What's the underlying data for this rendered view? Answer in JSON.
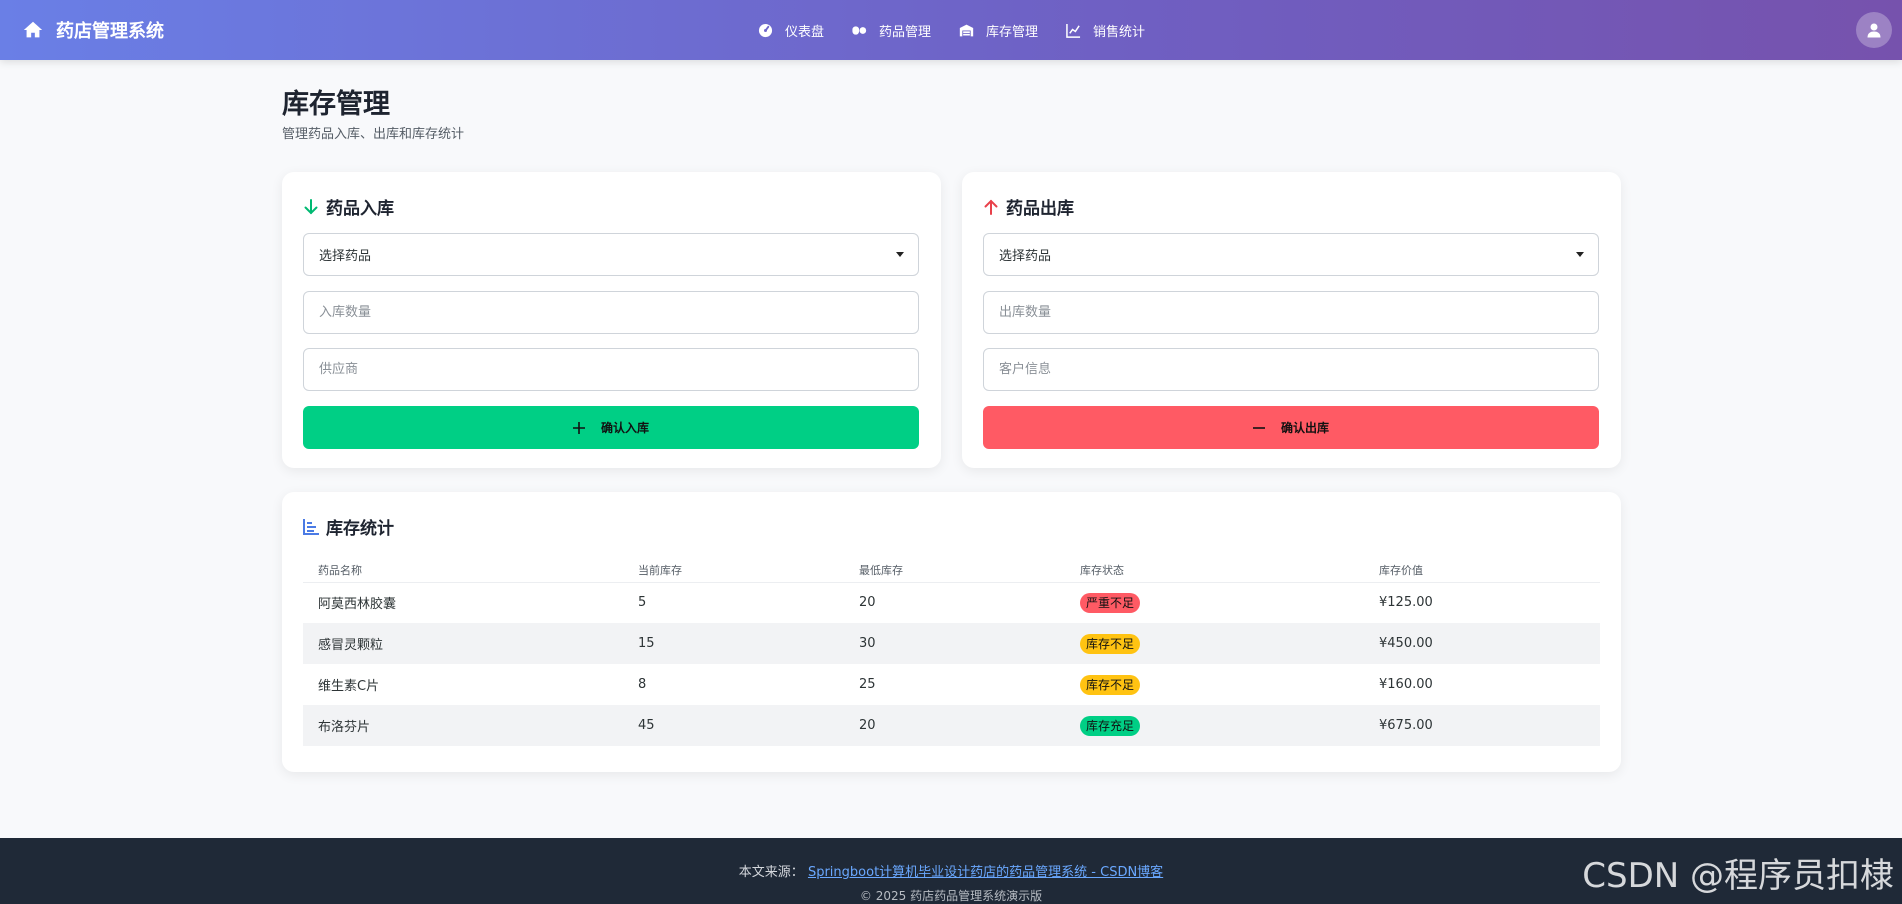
{
  "navbar": {
    "brand": "药店管理系统",
    "links": [
      "仪表盘",
      "药品管理",
      "库存管理",
      "销售统计"
    ]
  },
  "page": {
    "title": "库存管理",
    "subtitle": "管理药品入库、出库和库存统计"
  },
  "inbound": {
    "title": "药品入库",
    "select_value": "选择药品",
    "qty_placeholder": "入库数量",
    "supplier_placeholder": "供应商",
    "button": "确认入库"
  },
  "outbound": {
    "title": "药品出库",
    "select_value": "选择药品",
    "qty_placeholder": "出库数量",
    "customer_placeholder": "客户信息",
    "button": "确认出库"
  },
  "stats": {
    "title": "库存统计",
    "headers": [
      "药品名称",
      "当前库存",
      "最低库存",
      "库存状态",
      "库存价值"
    ],
    "rows": [
      {
        "name": "阿莫西林胶囊",
        "current": "5",
        "min": "20",
        "status": "严重不足",
        "value": "¥125.00"
      },
      {
        "name": "感冒灵颗粒",
        "current": "15",
        "min": "30",
        "status": "库存不足",
        "value": "¥450.00"
      },
      {
        "name": "维生素C片",
        "current": "8",
        "min": "25",
        "status": "库存不足",
        "value": "¥160.00"
      },
      {
        "name": "布洛芬片",
        "current": "45",
        "min": "20",
        "status": "库存充足",
        "value": "¥675.00"
      }
    ]
  },
  "footer": {
    "source_label": "本文来源：",
    "source_link": "Springboot计算机毕业设计药店的药品管理系统 - CSDN博客",
    "copyright": "© 2025 药店药品管理系统演示版"
  },
  "watermark": "CSDN @程序员扣棣",
  "colors": {
    "nav_start": "#6a7fe6",
    "nav_end": "#7652ad",
    "inbound_button": "#00cf85",
    "outbound_button": "#ff5a64",
    "status_critical": "#ff5a64",
    "status_low": "#ffc312",
    "status_ok": "#00cf85",
    "footer_bg": "#1f2937"
  }
}
